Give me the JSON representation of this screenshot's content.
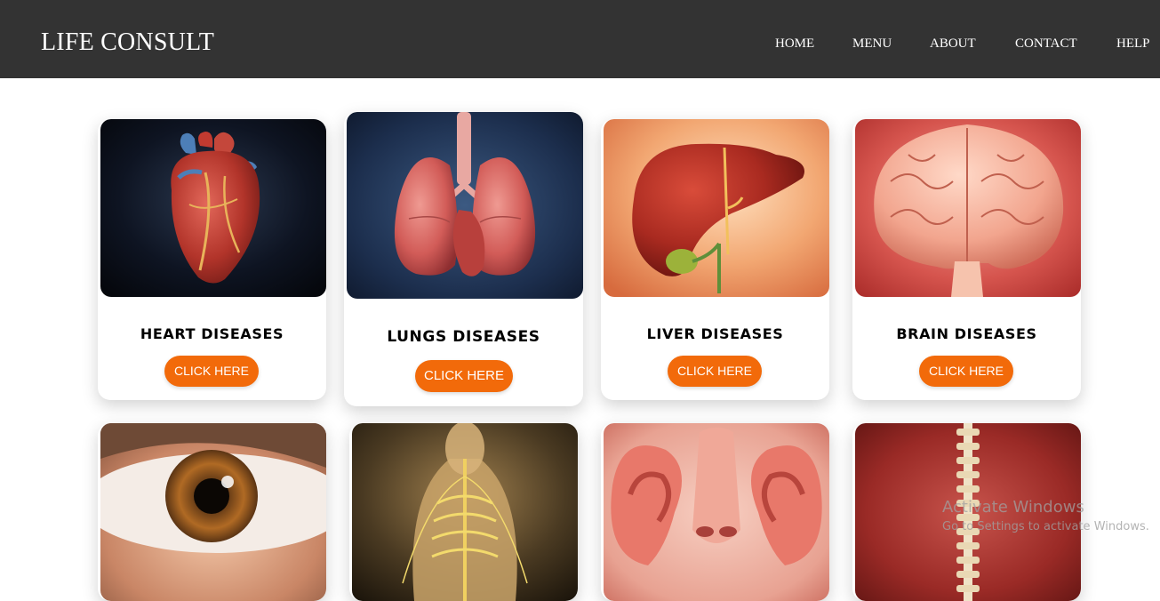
{
  "header": {
    "brand": "LIFE CONSULT",
    "nav": [
      "HOME",
      "MENU",
      "ABOUT",
      "CONTACT",
      "HELP"
    ]
  },
  "cards": [
    {
      "title": "HEART DISEASES",
      "button": "CLICK HERE",
      "image": "heart-image"
    },
    {
      "title": "LUNGS DISEASES",
      "button": "CLICK HERE",
      "image": "lungs-image"
    },
    {
      "title": "LIVER DISEASES",
      "button": "CLICK HERE",
      "image": "liver-image"
    },
    {
      "title": "BRAIN DISEASES",
      "button": "CLICK HERE",
      "image": "brain-image"
    },
    {
      "image": "eye-image"
    },
    {
      "image": "nervous-system-image"
    },
    {
      "image": "ear-nose-image"
    },
    {
      "image": "spine-image"
    }
  ],
  "watermark": {
    "title": "Activate Windows",
    "subtitle": "Go to Settings to activate Windows."
  },
  "colors": {
    "navbar": "#333333",
    "accent": "#f26a0a",
    "background": "#ffffff"
  }
}
